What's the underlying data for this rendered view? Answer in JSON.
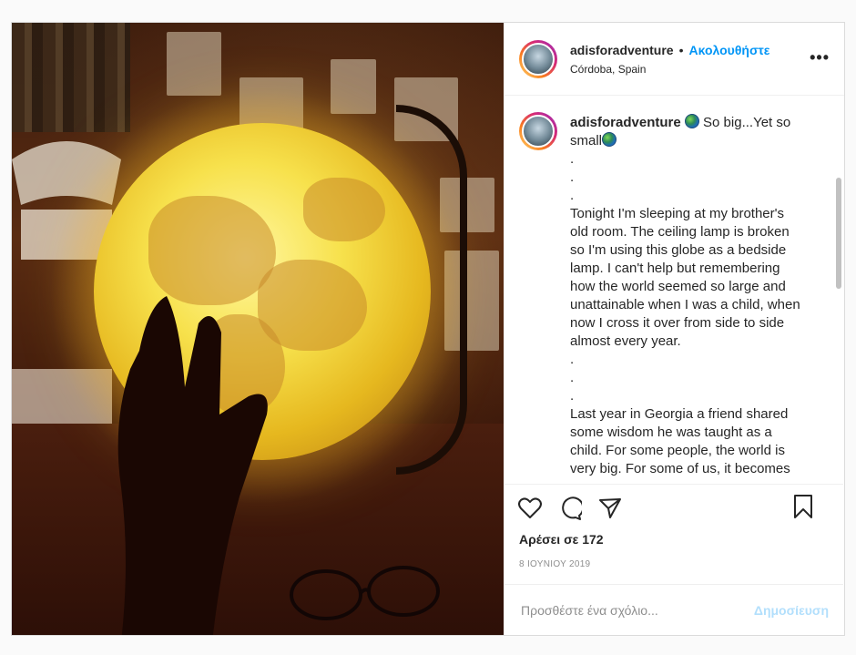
{
  "post": {
    "username": "adisforadventure",
    "separator": "•",
    "follow_label": "Ακολουθήστε",
    "location": "Córdoba, Spain",
    "more_label": "•••"
  },
  "caption": {
    "username": "adisforadventure",
    "lines": [
      "So big...Yet so",
      "small",
      ".",
      ".",
      ".",
      "Tonight I'm sleeping at my brother's",
      "old room. The ceiling lamp is broken",
      "so I'm using this globe as a bedside",
      "lamp. I can't help but remembering",
      "how the world seemed so large and",
      "unattainable when I was a child, when",
      "now I cross it over from side to side",
      "almost every year.",
      ".",
      ".",
      ".",
      "Last year in Georgia a friend shared",
      "some wisdom he was taught as a",
      "child. For some people, the world is",
      "very big. For some of us, it becomes"
    ]
  },
  "likes": "Αρέσει σε 172",
  "date": "8 ΙΟΥΝΙΟΥ 2019",
  "comment": {
    "placeholder": "Προσθέστε ένα σχόλιο...",
    "publish_label": "Δημοσίευση"
  },
  "icons": {
    "like": "heart-icon",
    "comment": "comment-icon",
    "share": "share-icon",
    "save": "bookmark-icon",
    "emoji": "globe-emoji-icon"
  },
  "colors": {
    "accent": "#0095f6",
    "publish_disabled": "#b2dffc",
    "muted": "#8e8e8e"
  }
}
